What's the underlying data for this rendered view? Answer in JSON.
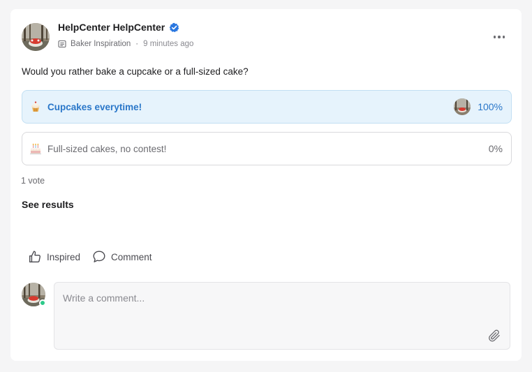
{
  "post": {
    "author": "HelpCenter HelpCenter",
    "space": "Baker Inspiration",
    "separator": "·",
    "time": "9 minutes ago",
    "question": "Would you rather bake a cupcake or a full-sized cake?"
  },
  "poll": {
    "options": [
      {
        "label": "Cupcakes everytime!",
        "percent": "100%",
        "emoji": "cupcake-icon",
        "selected": true
      },
      {
        "label": "Full-sized cakes, no contest!",
        "percent": "0%",
        "emoji": "birthday-cake-icon",
        "selected": false
      }
    ],
    "votes": "1 vote",
    "see_results": "See results"
  },
  "actions": {
    "inspired": "Inspired",
    "comment": "Comment"
  },
  "comment_box": {
    "placeholder": "Write a comment..."
  },
  "colors": {
    "accent": "#2a77c9",
    "selected_bg": "#e6f3fc",
    "online": "#2ec98a"
  }
}
